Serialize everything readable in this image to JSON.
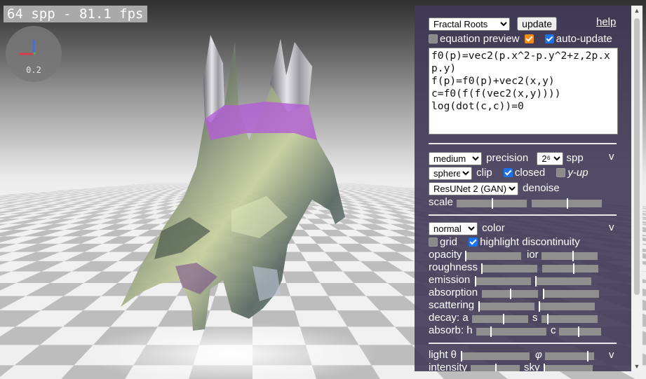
{
  "hud": {
    "fps_text": "64 spp - 81.1 fps",
    "gizmo_scale": "0.2"
  },
  "panel": {
    "preset_select": "Fractal Roots",
    "update_button": "update",
    "help_link": "help",
    "equation_preview_label": "equation preview",
    "auto_update_label": "auto-update",
    "code": "f0(p)=vec2(p.x^2-p.y^2+z,2p.x p.y)\nf(p)=f0(p)+vec2(x,y)\nc=f0(f(f(vec2(x,y))))\nlog(dot(c,c))=0",
    "render": {
      "quality_select": "medium",
      "precision_label": "precision",
      "spp_select": "2⁶",
      "spp_label": "spp",
      "clip_select": "sphere",
      "clip_label": "clip",
      "closed_label": "closed",
      "yup_label": "y-up",
      "denoise_select": "ResUNet 2 (GAN)",
      "denoise_label": "denoise",
      "scale_label": "scale",
      "chevron": "v",
      "scale_levels": [
        0.5,
        0.5
      ]
    },
    "color": {
      "mode_select": "normal",
      "color_label": "color",
      "grid_label": "grid",
      "highlight_label": "highlight discontinuity",
      "chevron": "v",
      "rows": [
        {
          "label": "opacity",
          "label2": "ior",
          "levels": [
            0.0,
            0.55
          ]
        },
        {
          "label": "roughness",
          "label2": "",
          "levels": [
            0.0,
            0.55
          ]
        },
        {
          "label": "emission",
          "label2": "",
          "levels": [
            0.0,
            0.0
          ]
        },
        {
          "label": "absorption",
          "label2": "",
          "levels": [
            0.5,
            0.0
          ]
        },
        {
          "label": "scattering",
          "label2": "",
          "levels": [
            0.0,
            0.0
          ]
        },
        {
          "label": "decay: a",
          "label2": "s",
          "levels": [
            0.55,
            0.1
          ]
        },
        {
          "label": "absorb: h",
          "label2": "c",
          "levels": [
            0.2,
            0.45
          ]
        }
      ]
    },
    "light": {
      "light_label": "light θ",
      "phi_label": "φ",
      "intensity_label": "intensity",
      "sky_label": "sky",
      "chevron": "v",
      "theta_level": 0.0,
      "phi_level": 0.85,
      "intensity_level": 0.5,
      "sky_level": 0.0
    }
  }
}
